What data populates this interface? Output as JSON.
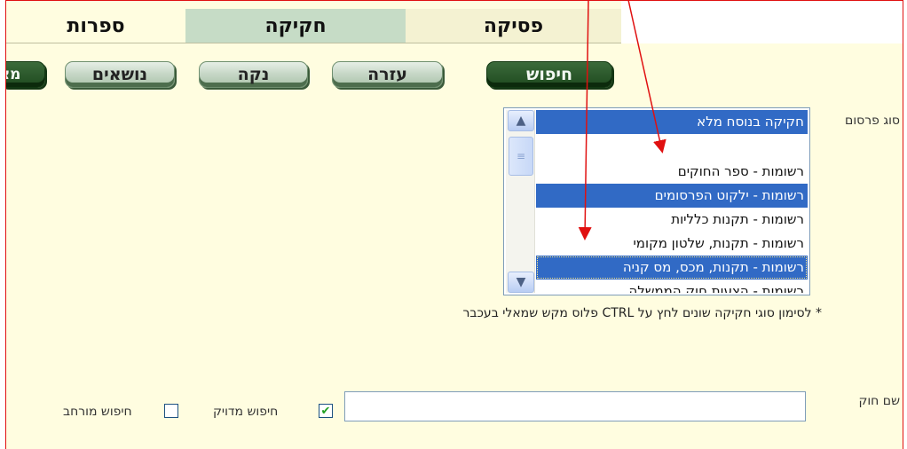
{
  "tabs": [
    {
      "label": "ספרות"
    },
    {
      "label": "חקיקה"
    },
    {
      "label": "פסיקה"
    }
  ],
  "buttons": {
    "topics": "נושאים",
    "clear": "נקה",
    "help": "עזרה",
    "search": "חיפוש",
    "extra": "מצ"
  },
  "form": {
    "pub_type_label": "סוג פרסום",
    "law_name_label": "שם חוק",
    "law_name_value": "",
    "multi_select_hint": "* לסימון סוגי חקיקה שונים לחץ על CTRL פלוס מקש שמאלי בעכבר",
    "exact_search_label": "חיפוש מדויק",
    "exact_search_checked": true,
    "broad_search_label": "חיפוש מורחב",
    "broad_search_checked": false
  },
  "listbox": {
    "items": [
      {
        "label": "חקיקה בנוסח מלא",
        "selected": true
      },
      {
        "label": "",
        "selected": false
      },
      {
        "label": "רשומות - ספר החוקים",
        "selected": false
      },
      {
        "label": "רשומות - ילקוט הפרסומים",
        "selected": true
      },
      {
        "label": "רשומות - תקנות כלליות",
        "selected": false
      },
      {
        "label": "רשומות - תקנות, שלטון מקומי",
        "selected": false
      },
      {
        "label": "רשומות - תקנות, מכס, מס קניה",
        "selected": true
      },
      {
        "label": "רשומות - הצעות חוק הממשלה",
        "selected": false
      }
    ]
  },
  "colors": {
    "page_bg": "#fffde0",
    "active_tab": "#c6dcc6",
    "selection": "#316ac5",
    "annotation": "#e01010"
  }
}
